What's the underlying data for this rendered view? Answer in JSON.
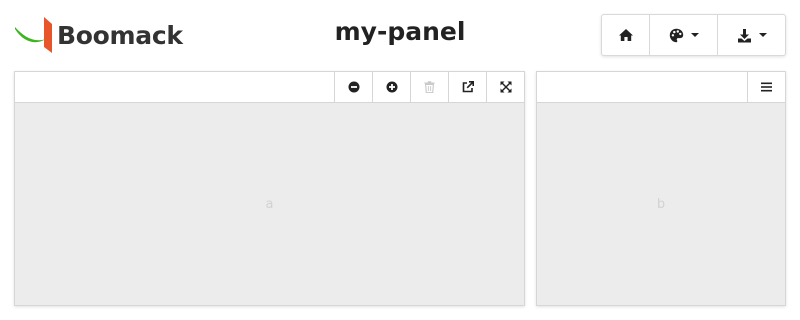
{
  "header": {
    "logo_text": "Boomack",
    "title": "my-panel",
    "logo_colors": {
      "swoosh": "#3cb51e",
      "flag": "#e8552a"
    }
  },
  "toolbar": {
    "buttons": [
      {
        "id": "home",
        "icon": "home-icon"
      },
      {
        "id": "theme",
        "icon": "palette-icon",
        "has_dropdown": true
      },
      {
        "id": "export",
        "icon": "download-icon",
        "has_dropdown": true
      }
    ]
  },
  "panels": [
    {
      "label": "a",
      "actions": [
        "minus-circle-icon",
        "plus-circle-icon",
        "trash-icon",
        "external-link-icon",
        "expand-icon"
      ],
      "disabled_actions": [
        "trash-icon"
      ]
    },
    {
      "label": "b",
      "actions": [
        "menu-icon"
      ]
    }
  ],
  "colors": {
    "panel_bg": "#ececec",
    "border": "#d6d6d6",
    "label": "#d2d2d2",
    "icon": "#222222",
    "icon_disabled": "#c8c8c8"
  }
}
